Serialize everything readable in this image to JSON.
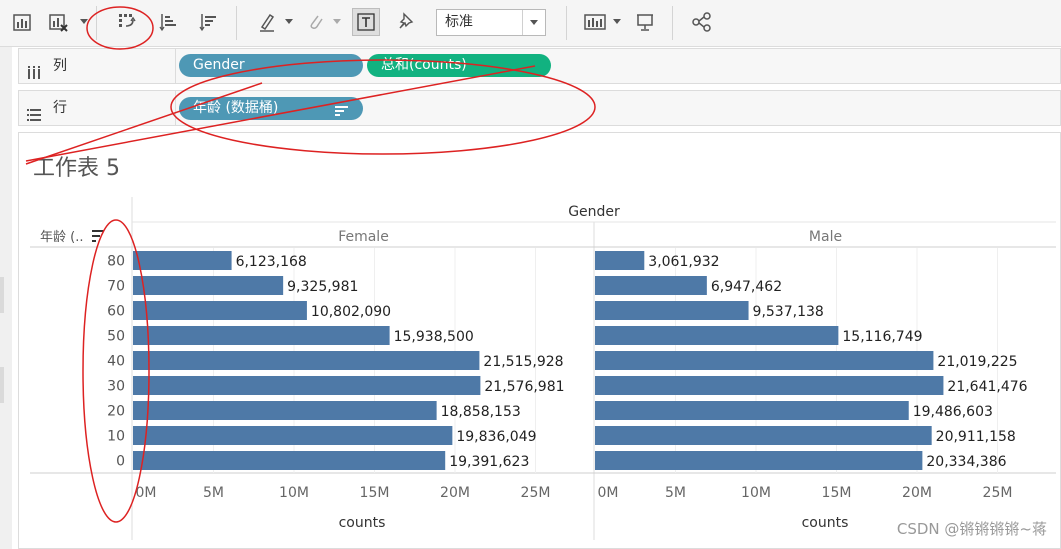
{
  "toolbar": {
    "icons": [
      "show-me-icon",
      "clear-sheet-icon",
      "swap-rows-columns-icon",
      "sort-ascending-icon",
      "sort-descending-icon",
      "highlight-icon",
      "group-icon",
      "show-mark-labels-icon",
      "pin-icon",
      "show-cards-icon",
      "presentation-icon",
      "share-icon"
    ],
    "fit_value": "标准"
  },
  "shelves": {
    "columns": {
      "label": "列",
      "pills": [
        {
          "text": "Gender",
          "kind": "dimension"
        },
        {
          "text": "总和(counts)",
          "kind": "measure"
        }
      ]
    },
    "rows": {
      "label": "行",
      "pills": [
        {
          "text": "年龄 (数据桶)",
          "kind": "dimension",
          "sorted": true
        }
      ]
    }
  },
  "sheet": {
    "title": "工作表 5"
  },
  "chart_data": {
    "type": "bar",
    "orientation": "horizontal",
    "column_header": "Gender",
    "row_header": "年龄 (..",
    "categories": [
      "80",
      "70",
      "60",
      "50",
      "40",
      "30",
      "20",
      "10",
      "0"
    ],
    "series": [
      {
        "name": "Female",
        "values": [
          6123168,
          9325981,
          10802090,
          15938500,
          21515928,
          21576981,
          18858153,
          19836049,
          19391623
        ],
        "labels": [
          "6,123,168",
          "9,325,981",
          "10,802,090",
          "15,938,500",
          "21,515,928",
          "21,576,981",
          "18,858,153",
          "19,836,049",
          "19,391,623"
        ]
      },
      {
        "name": "Male",
        "values": [
          3061932,
          6947462,
          9537138,
          15116749,
          21019225,
          21641476,
          19486603,
          20911158,
          20334386
        ],
        "labels": [
          "3,061,932",
          "6,947,462",
          "9,537,138",
          "15,116,749",
          "21,019,225",
          "21,641,476",
          "19,486,603",
          "20,911,158",
          "20,334,386"
        ]
      }
    ],
    "xlabel": "counts",
    "x_ticks": [
      0,
      5000000,
      10000000,
      15000000,
      20000000,
      25000000
    ],
    "x_tick_labels": [
      "0M",
      "5M",
      "10M",
      "15M",
      "20M",
      "25M"
    ],
    "xlim": [
      0,
      26000000
    ],
    "grid": true,
    "bar_color": "#4e79a7"
  },
  "watermark": "CSDN @锵锵锵锵~蒋",
  "colors": {
    "dimension_pill": "#4e98b5",
    "measure_pill": "#11b280",
    "annotation": "#dd2222"
  }
}
